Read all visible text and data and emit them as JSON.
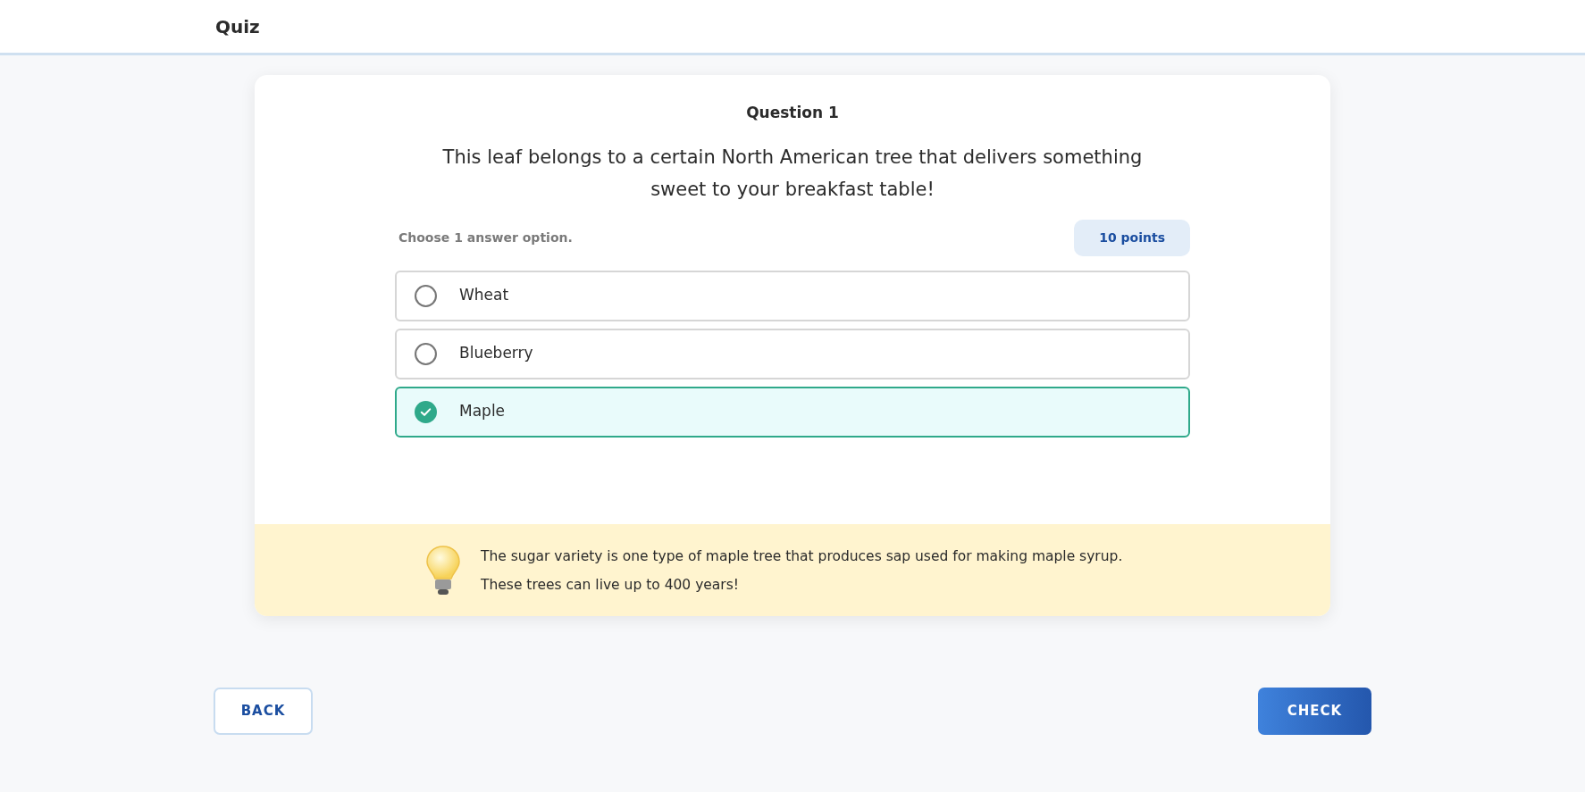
{
  "header": {
    "title": "Quiz"
  },
  "question": {
    "heading": "Question 1",
    "text": "This leaf belongs to a certain North American tree that delivers something sweet to your breakfast table!"
  },
  "instruction": "Choose 1 answer option.",
  "points": "10 points",
  "options": [
    {
      "label": "Wheat",
      "selected": false
    },
    {
      "label": "Blueberry",
      "selected": false
    },
    {
      "label": "Maple",
      "selected": true
    }
  ],
  "hint": {
    "text": "The sugar variety is one type of maple tree that produces sap used for making maple syrup. These trees can live up to 400 years!"
  },
  "buttons": [
    {
      "label": "BACK",
      "kind": "secondary"
    },
    {
      "label": "CHECK",
      "kind": "primary"
    }
  ]
}
